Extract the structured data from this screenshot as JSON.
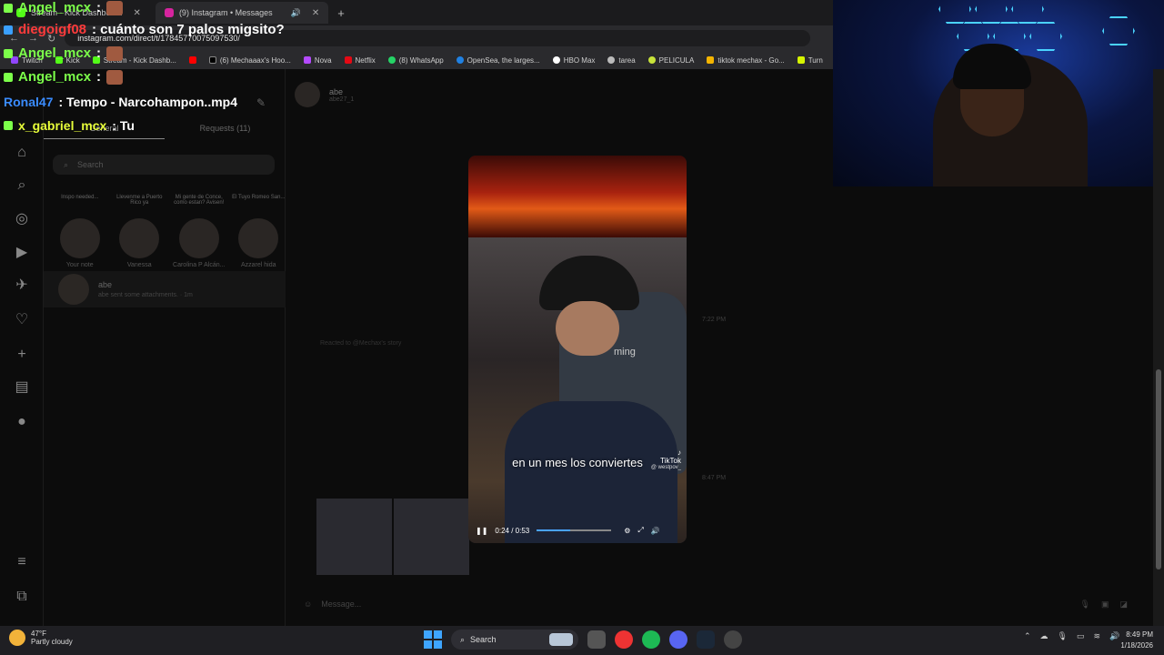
{
  "browser": {
    "tabs": [
      {
        "label": "Stream - Kick Dashboard",
        "active": false
      },
      {
        "label": "(9) Instagram • Messages",
        "active": true
      }
    ],
    "url": "instagram.com/direct/t/17845770075097530/",
    "bookmarks": [
      "Twitch",
      "Kick",
      "Stream - Kick Dashb...",
      "",
      "(6) Mechaaax's Hoo...",
      "Nova",
      "Netflix",
      "(8) WhatsApp",
      "OpenSea, the larges...",
      "HBO Max",
      "tarea",
      "PELICULA",
      "tiktok mechax - Go...",
      "Turn"
    ]
  },
  "chat": [
    {
      "user": "Angel_mcx",
      "message": "",
      "color": "#7cff4a"
    },
    {
      "user": "diegoigf08",
      "message": ": cuánto son 7 palos migsito?",
      "color": "#ff3b3b"
    },
    {
      "user": "Angel_mcx",
      "message": "",
      "color": "#7cff4a"
    },
    {
      "user": "Angel_mcx",
      "message": "",
      "color": "#7cff4a"
    },
    {
      "user": "Ronal47",
      "message": ": Tempo - Narcohampon..mp4",
      "color": "#3a8cff"
    },
    {
      "user": "x_gabriel_mcx",
      "message": ": Tu",
      "color": "#e8ff3a"
    }
  ],
  "inbox": {
    "tabs": [
      "General",
      "Requests (11)"
    ],
    "search_placeholder": "Search",
    "notes": [
      {
        "bubble": "Inspo needed...",
        "name": "Your note"
      },
      {
        "bubble": "Llevenme a Puerto Rico ya",
        "name": "Vanessa"
      },
      {
        "bubble": "Mi gente de Conce, como estan? Avisen!",
        "name": "Carolina P Alcán..."
      },
      {
        "bubble": "El Tuyo Romeo San...",
        "name": "Azzarel hida"
      }
    ],
    "conversation": {
      "name": "abe",
      "preview": "abe sent some attachments. · 1m"
    }
  },
  "thread": {
    "name": "abe",
    "username": "abe27_1",
    "timestamps": [
      "7:22 PM",
      "8:47 PM"
    ],
    "reacted": "Reacted to @Mechax's story",
    "message_placeholder": "Message..."
  },
  "video": {
    "caption": "en un mes los conviertes",
    "brand": "TikTok",
    "handle": "@ westpov_",
    "time": "0:24 / 0:53",
    "progress": 0.45,
    "chair_text": "ming"
  },
  "taskbar": {
    "temperature": "47°F",
    "weather": "Partly cloudy",
    "search": "Search",
    "time": "8:49 PM",
    "date": "1/18/2026"
  },
  "colors": {
    "accent": "#4aa3ff",
    "instagram_bg": "#0c0c0c"
  }
}
